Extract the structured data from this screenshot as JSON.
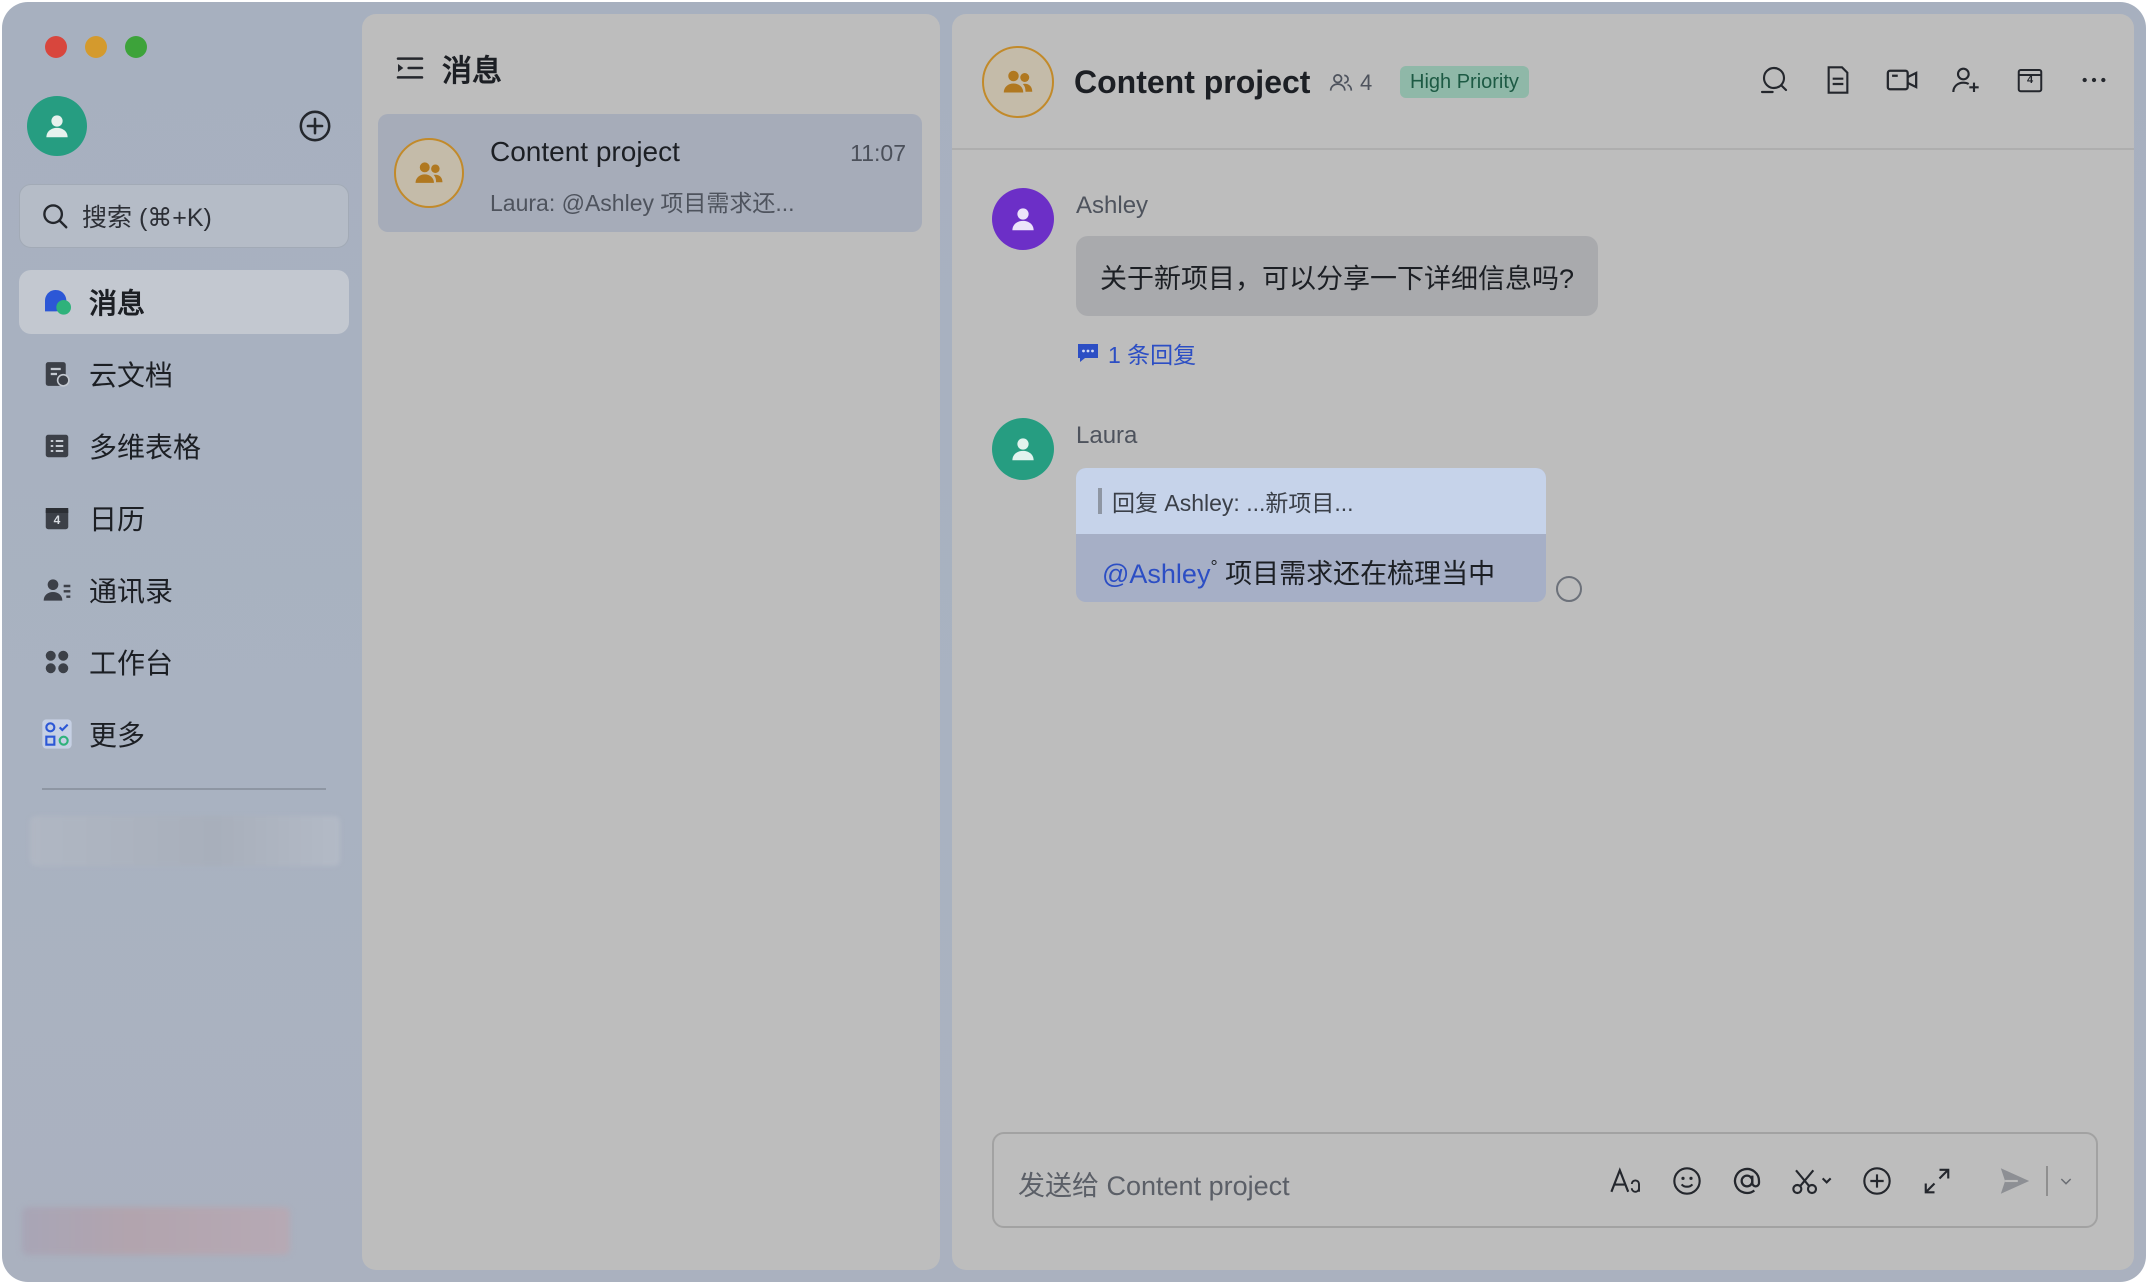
{
  "window": {
    "traffic_lights": [
      "#d8463d",
      "#d49a2d",
      "#3da33a"
    ]
  },
  "sidebar": {
    "search_placeholder": "搜索 (⌘+K)",
    "items": [
      {
        "label": "消息",
        "icon": "chat-bubble-icon",
        "active": true
      },
      {
        "label": "云文档",
        "icon": "cloud-docs-icon",
        "active": false
      },
      {
        "label": "多维表格",
        "icon": "table-icon",
        "active": false
      },
      {
        "label": "日历",
        "icon": "calendar-icon",
        "active": false
      },
      {
        "label": "通讯录",
        "icon": "contacts-icon",
        "active": false
      },
      {
        "label": "工作台",
        "icon": "workplace-icon",
        "active": false
      },
      {
        "label": "更多",
        "icon": "more-apps-icon",
        "active": false
      }
    ],
    "calendar_day": "4"
  },
  "conversations": {
    "header": "消息",
    "items": [
      {
        "title": "Content project",
        "time": "11:07",
        "preview": "Laura: @Ashley 项目需求还..."
      }
    ]
  },
  "chat": {
    "title": "Content project",
    "member_count": "4",
    "badge": "High Priority",
    "tool_calendar_day": "4",
    "messages": [
      {
        "sender": "Ashley",
        "text": "关于新项目，可以分享一下详细信息吗?",
        "replies": "1 条回复",
        "avatar_color": "#6c2fc7"
      },
      {
        "sender": "Laura",
        "quote": "回复 Ashley: ...新项目...",
        "mention": "@Ashley",
        "mention_mark": "°",
        "text": " 项目需求还在梳理当中",
        "avatar_color": "#269d81"
      }
    ],
    "composer_placeholder": "发送给 Content project"
  },
  "colors": {
    "accent_link": "#2c4ec4",
    "badge_bg": "#8fb8a8",
    "badge_text": "#1d5a44",
    "group_avatar_ring": "#c28a2a"
  }
}
